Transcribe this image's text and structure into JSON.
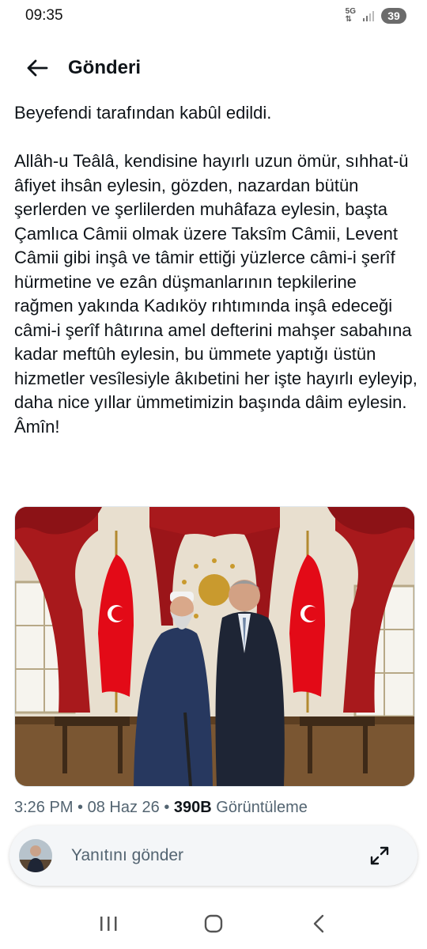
{
  "status": {
    "time": "09:35",
    "network": "5G",
    "battery": "39"
  },
  "header": {
    "title": "Gönderi"
  },
  "tweet": {
    "text": "Beyefendi tarafından kabûl edildi.\n\nAllâh-u Teâlâ, kendisine hayırlı uzun ömür, sıhhat-ü âfiyet ihsân eylesin, gözden, nazardan bütün şerlerden ve şerlilerden muhâfaza eylesin, başta Çamlıca Câmii olmak üzere Taksîm Câmii, Levent Câmii gibi inşâ ve tâmir ettiği yüzlerce câmi-i şerîf hürmetine ve ezân düşmanlarının tepkilerine rağmen yakında Kadıköy rıhtımında inşâ edeceği câmi-i şerîf hâtırına amel defterini mahşer sabahına kadar meftûh eylesin, bu ümmete yaptığı üstün hizmetler vesîlesiyle âkıbetini her işte hayırlı eyleyip, daha nice yıllar ümmetimizin başında dâim eylesin. Âmîn!",
    "time": "3:26 PM",
    "date": "08 Haz 26",
    "views_count": "390B",
    "views_label": "Görüntüleme"
  },
  "reply": {
    "placeholder": "Yanıtını gönder"
  },
  "colors": {
    "text": "#0f1419",
    "muted": "#536471",
    "curtain": "#a8191c",
    "flag": "#e30a17"
  }
}
